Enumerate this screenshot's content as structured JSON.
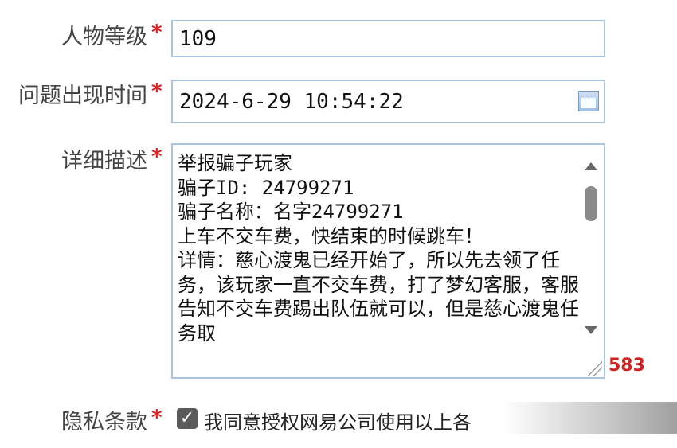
{
  "form": {
    "level": {
      "label": "人物等级",
      "required_mark": "*",
      "value": "109"
    },
    "issue_time": {
      "label": "问题出现时间",
      "required_mark": "*",
      "value": "2024-6-29 10:54:22",
      "icon": "calendar-icon"
    },
    "description": {
      "label": "详细描述",
      "required_mark": "*",
      "value": "举报骗子玩家\n骗子ID: 24799271\n骗子名称：名字24799271\n上车不交车费，快结束的时候跳车！\n详情：慈心渡鬼已经开始了，所以先去领了任务，该玩家一直不交车费，打了梦幻客服，客服告知不交车费踢出队伍就可以，但是慈心渡鬼任务取",
      "char_count": "583"
    },
    "privacy": {
      "label": "隐私条款",
      "required_mark": "*",
      "checked": true,
      "checkbox_glyph": "✓",
      "agree_text": "我同意授权网易公司使用以上各"
    }
  },
  "colors": {
    "required": "#e02020",
    "input_border": "#a9c4dc",
    "count": "#d02020"
  }
}
